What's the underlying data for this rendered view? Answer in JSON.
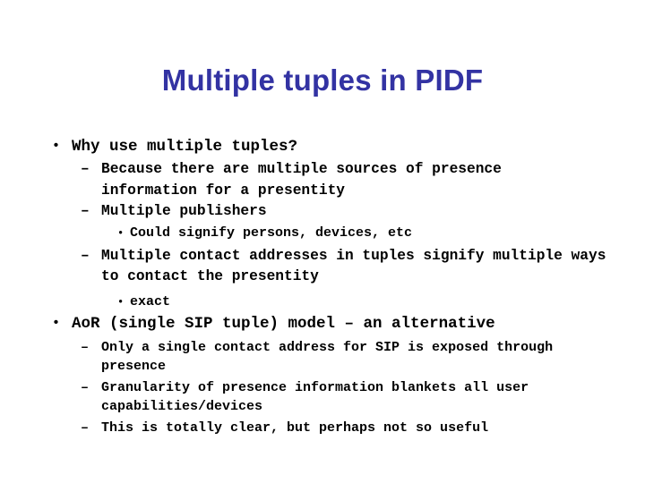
{
  "slide": {
    "title": "Multiple tuples in PIDF",
    "title_color": "#3333a3",
    "background_color": "#ffffff",
    "text_color": "#000000",
    "bullet_glyph_level1": "•",
    "bullet_glyph_level2": "–",
    "bullet_glyph_level3": "•",
    "content": [
      {
        "level": 1,
        "text": "Why use multiple tuples?"
      },
      {
        "level": 2,
        "text": "Because there are multiple sources of presence information for a presentity"
      },
      {
        "level": 2,
        "text": "Multiple publishers"
      },
      {
        "level": 3,
        "text": "Could signify persons, devices, etc"
      },
      {
        "level": 2,
        "text": "Multiple contact addresses in tuples signify multiple ways to contact the presentity"
      },
      {
        "level": 3,
        "text": "exact"
      },
      {
        "level": 1,
        "text": "AoR (single SIP tuple) model – an alternative"
      },
      {
        "level": 2,
        "text": "Only a single contact address for SIP is exposed through presence"
      },
      {
        "level": 2,
        "text": "Granularity of presence information blankets all user capabilities/devices"
      },
      {
        "level": 2,
        "text": "This is totally clear, but perhaps not so useful"
      }
    ]
  }
}
